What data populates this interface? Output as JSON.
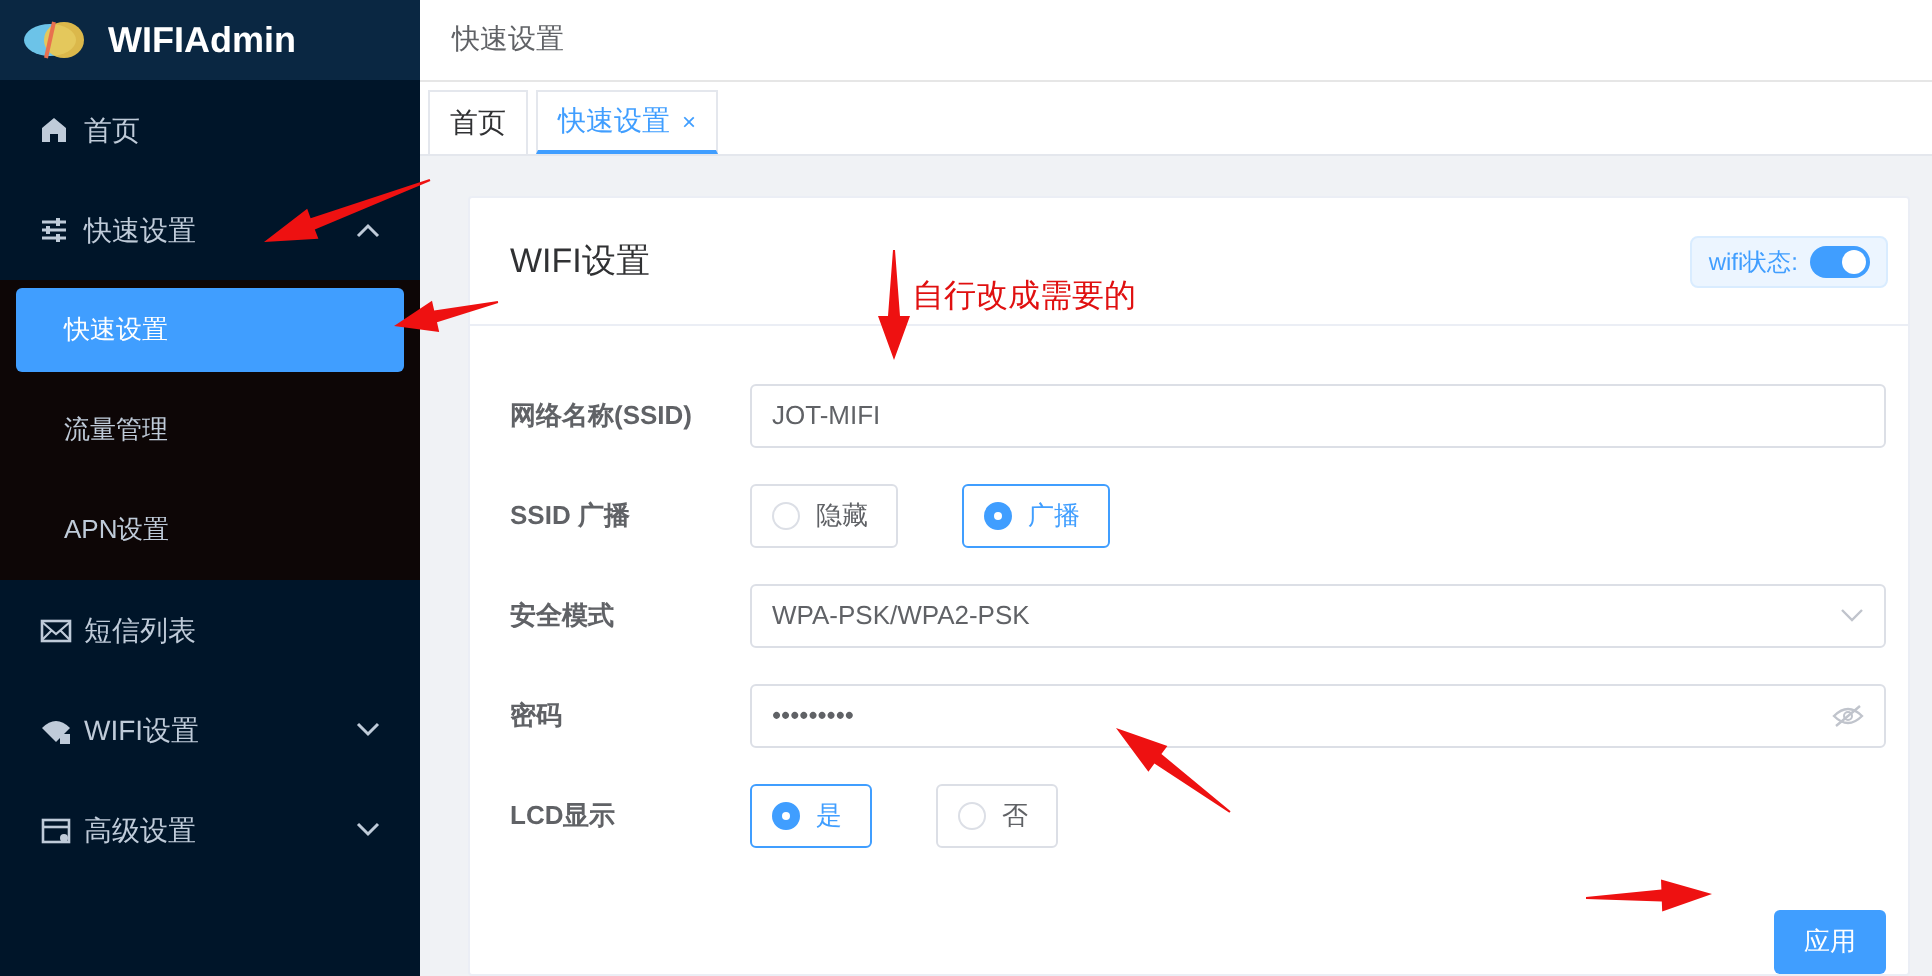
{
  "sidebar": {
    "brand": "WIFIAdmin",
    "items": [
      {
        "label": "首页"
      },
      {
        "label": "快速设置",
        "expanded": true,
        "children": [
          {
            "label": "快速设置",
            "selected": true
          },
          {
            "label": "流量管理",
            "selected": false
          },
          {
            "label": "APN设置",
            "selected": false
          }
        ]
      },
      {
        "label": "短信列表"
      },
      {
        "label": "WIFI设置",
        "expanded": false
      },
      {
        "label": "高级设置",
        "expanded": false
      }
    ]
  },
  "header": {
    "breadcrumb": "快速设置"
  },
  "tabs": [
    {
      "label": "首页",
      "selected": false
    },
    {
      "label": "快速设置",
      "selected": true,
      "close": "×"
    }
  ],
  "card": {
    "title": "WIFI设置",
    "wifi_status": {
      "label": "wifi状态:",
      "on": true
    },
    "fields": [
      {
        "kind": "text",
        "label": "网络名称(SSID)",
        "value": "JOT-MIFI"
      },
      {
        "kind": "radio",
        "label": "SSID 广播",
        "options": [
          {
            "label": "隐藏",
            "selected": false
          },
          {
            "label": "广播",
            "selected": true
          }
        ]
      },
      {
        "kind": "select",
        "label": "安全模式",
        "value": "WPA-PSK/WPA2-PSK"
      },
      {
        "kind": "password",
        "label": "密码",
        "value": "•••••••••"
      },
      {
        "kind": "radio",
        "label": "LCD显示",
        "options": [
          {
            "label": "是",
            "selected": true
          },
          {
            "label": "否",
            "selected": false
          }
        ]
      }
    ],
    "submit": "应用"
  },
  "annotation": {
    "text": "自行改成需要的"
  }
}
